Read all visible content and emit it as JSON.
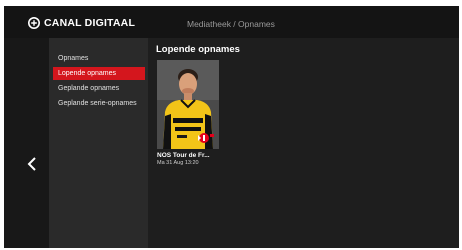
{
  "header": {
    "logo_text": "CANAL DIGITAAL",
    "breadcrumb": "Mediatheek / Opnames"
  },
  "sidebar": {
    "items": [
      {
        "label": "Opnames",
        "active": false
      },
      {
        "label": "Lopende opnames",
        "active": true
      },
      {
        "label": "Geplande opnames",
        "active": false
      },
      {
        "label": "Geplande serie-opnames",
        "active": false
      }
    ]
  },
  "main": {
    "section_title": "Lopende opnames",
    "cards": [
      {
        "title": "NOS Tour de Fr...",
        "meta": "Ma 31 Aug 13:20",
        "channel_badge": "NPO 1",
        "thumbnail_icon": "cyclist-portrait-image"
      }
    ]
  },
  "colors": {
    "accent": "#d4161d",
    "background": "#1e1e1e",
    "topbar": "#141414",
    "sidebar": "#2a2a2a"
  },
  "icons": {
    "logo": "canal-digitaal-logo-icon",
    "back": "chevron-left-icon"
  }
}
